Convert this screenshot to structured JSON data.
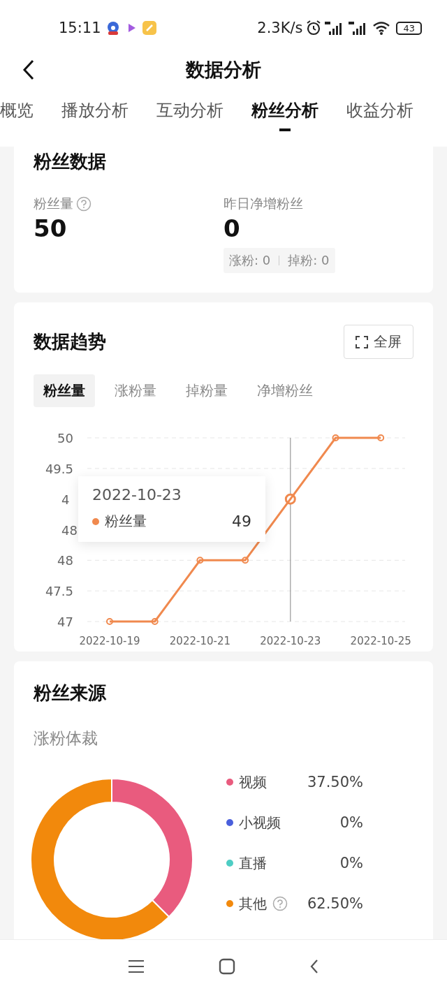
{
  "status_bar": {
    "time": "15:11",
    "net_speed": "2.3K/s",
    "battery": "43"
  },
  "header": {
    "title": "数据分析"
  },
  "tabs": [
    {
      "label": "概览",
      "selected": false
    },
    {
      "label": "播放分析",
      "selected": false
    },
    {
      "label": "互动分析",
      "selected": false
    },
    {
      "label": "粉丝分析",
      "selected": true
    },
    {
      "label": "收益分析",
      "selected": false
    }
  ],
  "fan_data": {
    "title": "粉丝数据",
    "total_label": "粉丝量",
    "total_value": "50",
    "net_label": "昨日净增粉丝",
    "net_value": "0",
    "gain_label": "涨粉:",
    "gain_value": "0",
    "loss_label": "掉粉:",
    "loss_value": "0"
  },
  "trend": {
    "title": "数据趋势",
    "fullscreen_label": "全屏",
    "subtabs": [
      {
        "label": "粉丝量",
        "selected": true
      },
      {
        "label": "涨粉量",
        "selected": false
      },
      {
        "label": "掉粉量",
        "selected": false
      },
      {
        "label": "净增粉丝",
        "selected": false
      }
    ],
    "chart_data": {
      "type": "line",
      "categories": [
        "2022-10-19",
        null,
        "2022-10-21",
        null,
        "2022-10-23",
        null,
        "2022-10-25"
      ],
      "series": [
        {
          "name": "粉丝量",
          "color": "#f0894e",
          "marker": "circle",
          "values": [
            47,
            47,
            48,
            48,
            49,
            50,
            50
          ]
        }
      ],
      "grid": true,
      "ylim": [
        47,
        50
      ],
      "yticks": [
        47,
        47.5,
        48,
        49.5,
        50
      ],
      "ref_lines": [
        {
          "axis": "x",
          "value": "2022-10-23",
          "color": "#999999"
        }
      ]
    },
    "covered_axis_labels": [
      "4",
      "48"
    ],
    "tooltip": {
      "date": "2022-10-23",
      "value": "49"
    }
  },
  "source": {
    "title": "粉丝来源",
    "subtitle": "涨粉体裁",
    "chart_data": {
      "type": "donut",
      "categories": [
        "视频",
        "小视频",
        "直播",
        "其他"
      ],
      "values": [
        37.5,
        0,
        0,
        62.5
      ]
    },
    "legend": [
      {
        "value": "37.50%",
        "color": "#e95b7e",
        "help": false
      },
      {
        "value": "0%",
        "color": "#4a5fdc",
        "help": false
      },
      {
        "value": "0%",
        "color": "#4ecdc4",
        "help": false
      },
      {
        "value": "62.50%",
        "color": "#f2890c",
        "help": true
      }
    ]
  }
}
